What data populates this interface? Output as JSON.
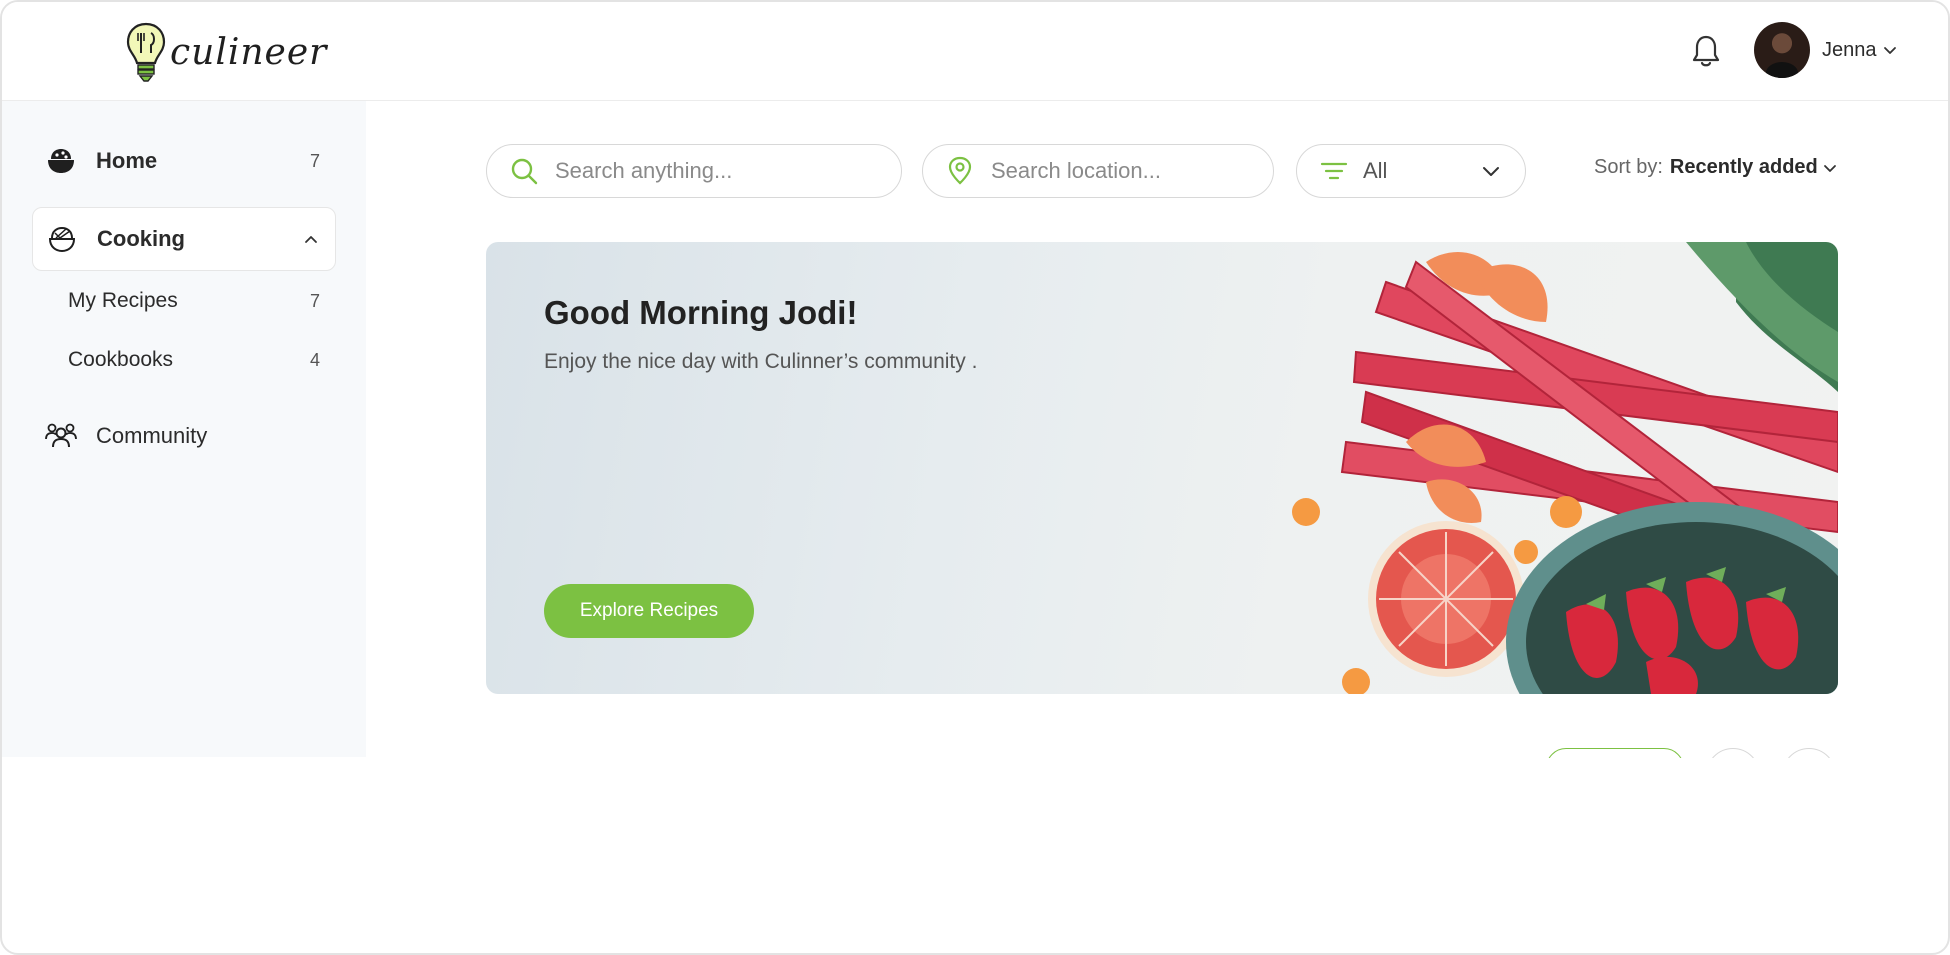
{
  "brand": {
    "logo_text": "culineer",
    "accent": "#7cc142"
  },
  "header": {
    "user_name": "Jenna",
    "notifications_icon": "bell-icon"
  },
  "sidebar": {
    "items": [
      {
        "label": "Home",
        "count": "7",
        "icon": "bowl-icon"
      },
      {
        "label": "Cooking",
        "icon": "pot-icon",
        "expanded": true
      },
      {
        "label": "My Recipes",
        "count": "7"
      },
      {
        "label": "Cookbooks",
        "count": "4"
      },
      {
        "label": "Community",
        "icon": "people-icon"
      }
    ]
  },
  "toolbar": {
    "search_placeholder": "Search anything...",
    "location_placeholder": "Search location...",
    "filter_value": "All",
    "sort_label": "Sort by:",
    "sort_value": "Recently added"
  },
  "hero": {
    "title": "Good Morning Jodi!",
    "subtitle": "Enjoy the nice day with Culinner’s community .",
    "button_label": "Explore Recipes"
  }
}
